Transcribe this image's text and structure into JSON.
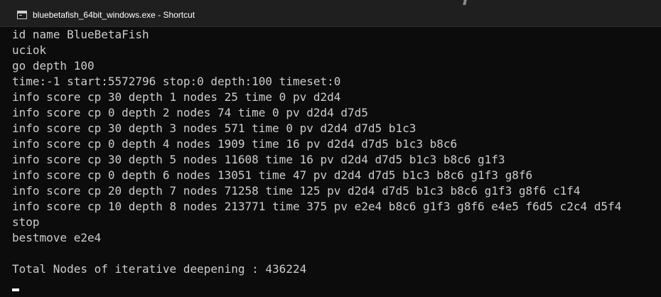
{
  "window": {
    "title": "bluebetafish_64bit_windows.exe - Shortcut"
  },
  "console": {
    "lines": [
      "id name BlueBetaFish",
      "uciok",
      "go depth 100",
      "time:-1 start:5572796 stop:0 depth:100 timeset:0",
      "info score cp 30 depth 1 nodes 25 time 0 pv d2d4",
      "info score cp 0 depth 2 nodes 74 time 0 pv d2d4 d7d5",
      "info score cp 30 depth 3 nodes 571 time 0 pv d2d4 d7d5 b1c3",
      "info score cp 0 depth 4 nodes 1909 time 16 pv d2d4 d7d5 b1c3 b8c6",
      "info score cp 30 depth 5 nodes 11608 time 16 pv d2d4 d7d5 b1c3 b8c6 g1f3",
      "info score cp 0 depth 6 nodes 13051 time 47 pv d2d4 d7d5 b1c3 b8c6 g1f3 g8f6",
      "info score cp 20 depth 7 nodes 71258 time 125 pv d2d4 d7d5 b1c3 b8c6 g1f3 g8f6 c1f4",
      "info score cp 10 depth 8 nodes 213771 time 375 pv e2e4 b8c6 g1f3 g8f6 e4e5 f6d5 c2c4 d5f4",
      "stop",
      "bestmove e2e4",
      "",
      "Total Nodes of iterative deepening : 436224"
    ]
  },
  "colors": {
    "background": "#0c0c0c",
    "titlebar": "#1f1f1f",
    "text": "#cccccc",
    "title_text": "#ffffff",
    "cursor": "#ffffff"
  }
}
